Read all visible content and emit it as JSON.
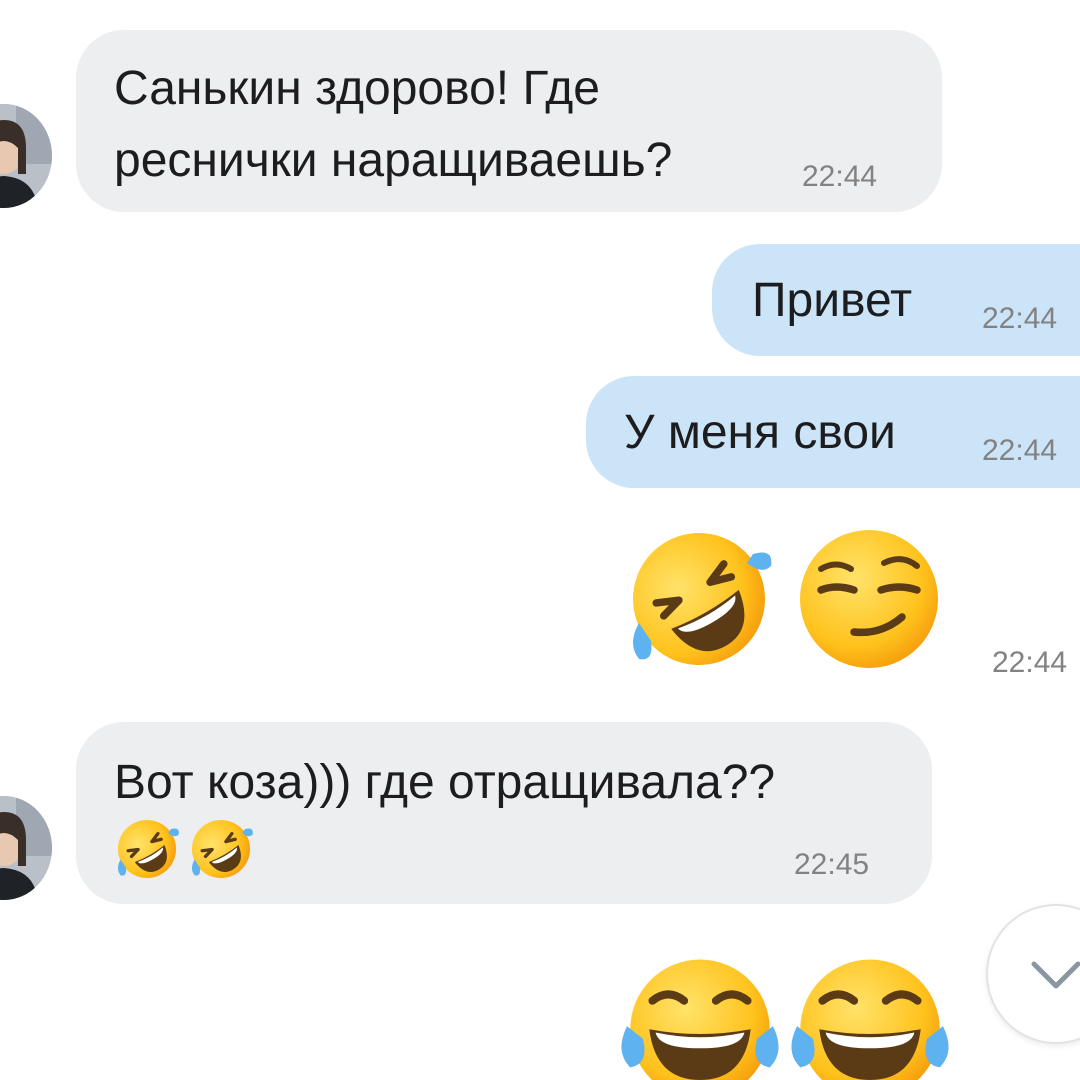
{
  "messages": [
    {
      "direction": "incoming",
      "text_line1": "Санькин здорово! Где",
      "text_line2": "реснички наращиваешь?",
      "time": "22:44"
    },
    {
      "direction": "outgoing",
      "text": "Привет",
      "time": "22:44"
    },
    {
      "direction": "outgoing",
      "text": "У меня свои",
      "time": "22:44"
    },
    {
      "direction": "outgoing",
      "emojis": [
        "rolling-on-floor-laughing",
        "smirking-face"
      ],
      "time": "22:44"
    },
    {
      "direction": "incoming",
      "text": "Вот коза))) где отращивала??",
      "emojis": [
        "rolling-on-floor-laughing",
        "rolling-on-floor-laughing"
      ],
      "time": "22:45"
    },
    {
      "direction": "outgoing",
      "emojis": [
        "face-with-tears-of-joy",
        "face-with-tears-of-joy"
      ]
    }
  ],
  "colors": {
    "incoming_bubble": "#edeef0",
    "outgoing_bubble": "#cce4f7",
    "timestamp": "#828282"
  },
  "icons": {
    "scroll_down": "chevron-down-icon"
  }
}
